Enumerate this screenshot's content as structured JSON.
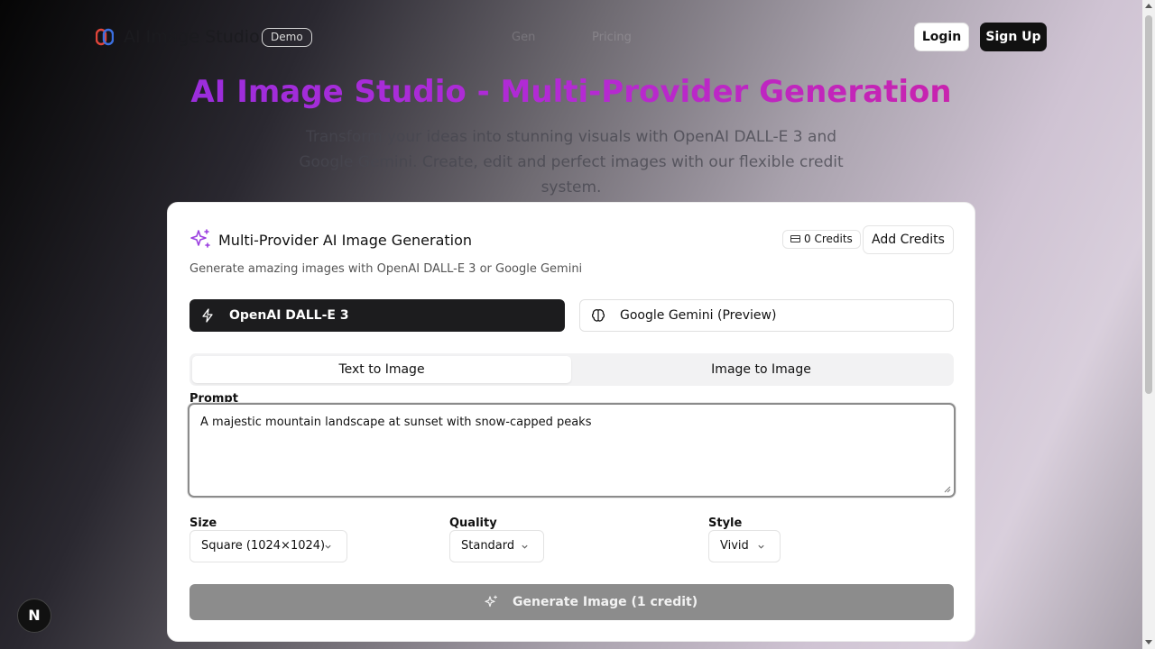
{
  "header": {
    "brand": "AI Image Studio",
    "badge": "Demo",
    "nav": [
      "Gen",
      "Pricing"
    ],
    "login": "Login",
    "signup": "Sign Up"
  },
  "hero": {
    "title": "AI Image Studio - Multi-Provider Generation",
    "subtitle": "Transform your ideas into stunning visuals with OpenAI DALL-E 3 and Google Gemini. Create, edit and perfect images with our flexible credit system."
  },
  "card": {
    "title": "Multi-Provider AI Image Generation",
    "credits": "0 Credits",
    "add_credits": "Add Credits",
    "description": "Generate amazing images with OpenAI DALL-E 3 or Google Gemini",
    "providers": [
      {
        "label": "OpenAI DALL-E 3",
        "icon": "lightning-icon",
        "active": true
      },
      {
        "label": "Google Gemini (Preview)",
        "icon": "brain-icon",
        "active": false
      }
    ],
    "tabs": [
      {
        "label": "Text to Image",
        "active": true
      },
      {
        "label": "Image to Image",
        "active": false
      }
    ],
    "prompt_label": "Prompt",
    "prompt_value": "A majestic mountain landscape at sunset with snow-capped peaks",
    "size_label": "Size",
    "size_value": "Square (1024×1024)",
    "quality_label": "Quality",
    "quality_value": "Standard",
    "style_label": "Style",
    "style_value": "Vivid",
    "generate": "Generate Image (1 credit)"
  },
  "dev_badge": "N",
  "colors": {
    "title_gradient_start": "#8f2fe0",
    "title_gradient_end": "#d21f9b",
    "active_provider_bg": "#1c1c1e",
    "generate_disabled_bg": "#8c8c8c"
  }
}
